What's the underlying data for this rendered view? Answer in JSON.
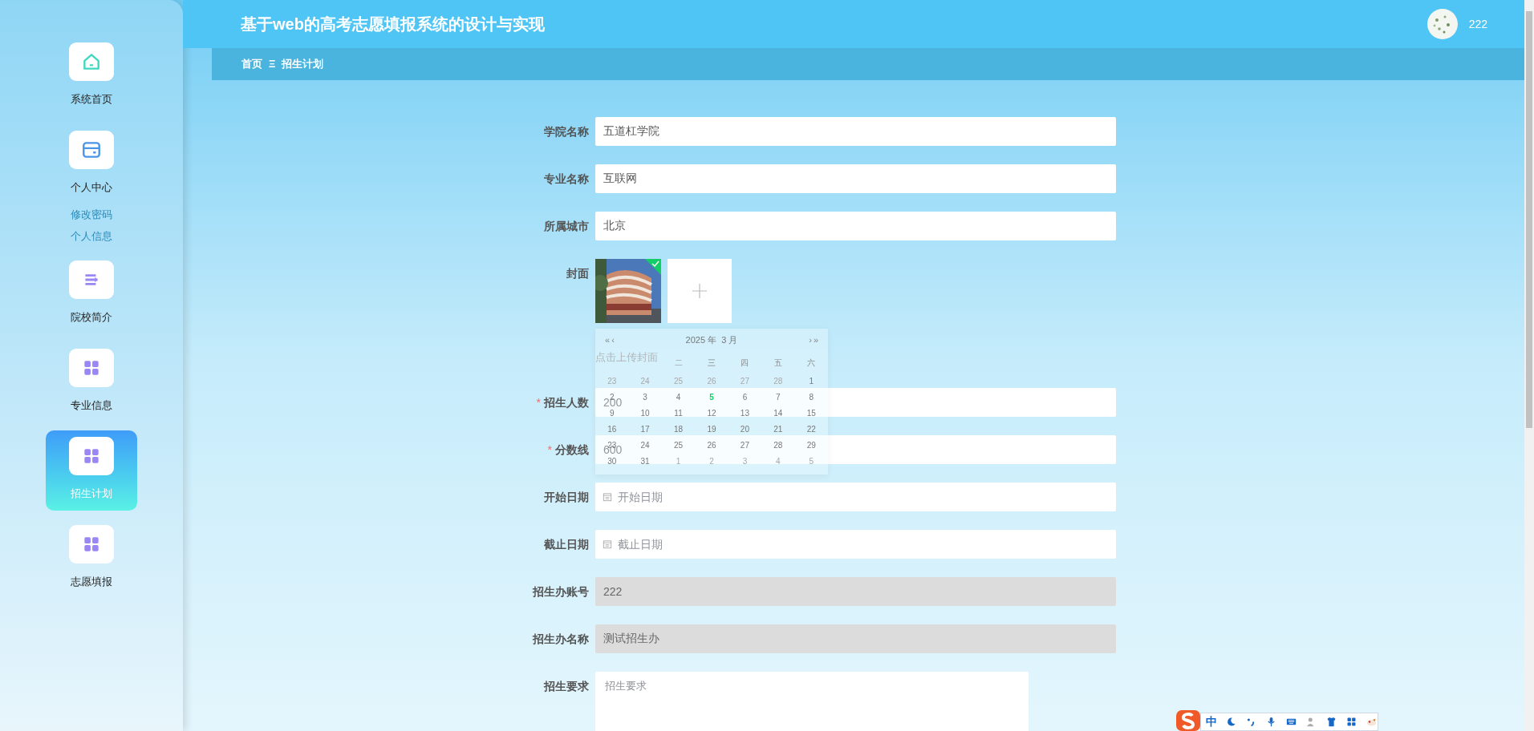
{
  "sidebar": {
    "items": [
      {
        "label": "系统首页",
        "selected": false
      },
      {
        "label": "个人中心",
        "selected": false,
        "children": [
          {
            "label": "修改密码"
          },
          {
            "label": "个人信息"
          }
        ]
      },
      {
        "label": "院校简介",
        "selected": false
      },
      {
        "label": "专业信息",
        "selected": false
      },
      {
        "label": "招生计划",
        "selected": true
      },
      {
        "label": "志愿填报",
        "selected": false
      }
    ]
  },
  "header": {
    "title": "基于web的高考志愿填报系统的设计与实现",
    "user": "222"
  },
  "breadcrumb": [
    "首页",
    "招生计划"
  ],
  "breadcrumb_separator": "Ξ",
  "form": {
    "required_mark": "*",
    "fields": [
      {
        "kind": "text",
        "label": "学院名称",
        "value": "五道杠学院",
        "required": false,
        "disabled": false
      },
      {
        "kind": "text",
        "label": "专业名称",
        "value": "互联网",
        "required": false,
        "disabled": false
      },
      {
        "kind": "text",
        "label": "所属城市",
        "value": "北京",
        "required": false,
        "disabled": false
      },
      {
        "kind": "upload",
        "label": "封面",
        "hint": "点击上传封面",
        "uploaded": true,
        "required": false,
        "disabled": false
      },
      {
        "kind": "text",
        "label": "招生人数",
        "value": "200",
        "required": true,
        "disabled": false
      },
      {
        "kind": "text",
        "label": "分数线",
        "value": "600",
        "required": true,
        "disabled": false
      },
      {
        "kind": "date",
        "label": "开始日期",
        "placeholder": "开始日期",
        "required": false,
        "disabled": false
      },
      {
        "kind": "date",
        "label": "截止日期",
        "placeholder": "截止日期",
        "required": false,
        "disabled": false
      },
      {
        "kind": "text",
        "label": "招生办账号",
        "value": "222",
        "required": false,
        "disabled": true
      },
      {
        "kind": "text",
        "label": "招生办名称",
        "value": "测试招生办",
        "required": false,
        "disabled": true
      },
      {
        "kind": "textarea",
        "label": "招生要求",
        "placeholder": "招生要求",
        "required": false,
        "disabled": false
      }
    ]
  },
  "date_picker": {
    "prev_year": "«",
    "prev_month": "‹",
    "title": "2025 年  3 月",
    "next_month": "›",
    "next_year": "»",
    "weekdays": [
      "二",
      "三",
      "四",
      "五",
      "六"
    ],
    "weeks": [
      [
        {
          "label": "23",
          "other_month": true,
          "today": false
        },
        {
          "label": "24",
          "other_month": true,
          "today": false
        },
        {
          "label": "25",
          "other_month": true,
          "today": false
        },
        {
          "label": "26",
          "other_month": true,
          "today": false
        },
        {
          "label": "27",
          "other_month": true,
          "today": false
        },
        {
          "label": "28",
          "other_month": true,
          "today": false
        },
        {
          "label": "1",
          "other_month": false,
          "today": false
        }
      ],
      [
        {
          "label": "2",
          "other_month": false,
          "today": false
        },
        {
          "label": "3",
          "other_month": false,
          "today": false
        },
        {
          "label": "4",
          "other_month": false,
          "today": false
        },
        {
          "label": "5",
          "other_month": false,
          "today": true
        },
        {
          "label": "6",
          "other_month": false,
          "today": false
        },
        {
          "label": "7",
          "other_month": false,
          "today": false
        },
        {
          "label": "8",
          "other_month": false,
          "today": false
        }
      ],
      [
        {
          "label": "9",
          "other_month": false,
          "today": false
        },
        {
          "label": "10",
          "other_month": false,
          "today": false
        },
        {
          "label": "11",
          "other_month": false,
          "today": false
        },
        {
          "label": "12",
          "other_month": false,
          "today": false
        },
        {
          "label": "13",
          "other_month": false,
          "today": false
        },
        {
          "label": "14",
          "other_month": false,
          "today": false
        },
        {
          "label": "15",
          "other_month": false,
          "today": false
        }
      ],
      [
        {
          "label": "16",
          "other_month": false,
          "today": false
        },
        {
          "label": "17",
          "other_month": false,
          "today": false
        },
        {
          "label": "18",
          "other_month": false,
          "today": false
        },
        {
          "label": "19",
          "other_month": false,
          "today": false
        },
        {
          "label": "20",
          "other_month": false,
          "today": false
        },
        {
          "label": "21",
          "other_month": false,
          "today": false
        },
        {
          "label": "22",
          "other_month": false,
          "today": false
        }
      ],
      [
        {
          "label": "23",
          "other_month": false,
          "today": false
        },
        {
          "label": "24",
          "other_month": false,
          "today": false
        },
        {
          "label": "25",
          "other_month": false,
          "today": false
        },
        {
          "label": "26",
          "other_month": false,
          "today": false
        },
        {
          "label": "27",
          "other_month": false,
          "today": false
        },
        {
          "label": "28",
          "other_month": false,
          "today": false
        },
        {
          "label": "29",
          "other_month": false,
          "today": false
        }
      ],
      [
        {
          "label": "30",
          "other_month": false,
          "today": false
        },
        {
          "label": "31",
          "other_month": false,
          "today": false
        },
        {
          "label": "1",
          "other_month": true,
          "today": false
        },
        {
          "label": "2",
          "other_month": true,
          "today": false
        },
        {
          "label": "3",
          "other_month": true,
          "today": false
        },
        {
          "label": "4",
          "other_month": true,
          "today": false
        },
        {
          "label": "5",
          "other_month": true,
          "today": false
        }
      ]
    ]
  },
  "ime_toolbar": {
    "mode": "中"
  }
}
